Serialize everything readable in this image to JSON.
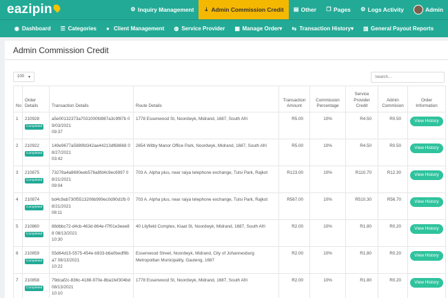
{
  "app": {
    "logo_text": "eazipin"
  },
  "top_nav": [
    {
      "label": "Inquiry Management",
      "icon": "gear-icon",
      "glyph": "⚙",
      "active": false
    },
    {
      "label": "Admin Commission Credit",
      "icon": "download-icon",
      "glyph": "⤓",
      "active": true
    },
    {
      "label": "Other",
      "icon": "chart-icon",
      "glyph": "▤",
      "active": false
    },
    {
      "label": "Pages",
      "icon": "pages-icon",
      "glyph": "❐",
      "active": false
    },
    {
      "label": "Logs Activity",
      "icon": "gear-icon",
      "glyph": "⚙",
      "active": false
    },
    {
      "label": "Admin",
      "icon": "avatar",
      "glyph": "",
      "active": false
    }
  ],
  "sub_nav": [
    {
      "label": "Dashboard",
      "icon": "dashboard-icon",
      "glyph": "◉",
      "dropdown": false
    },
    {
      "label": "Categories",
      "icon": "list-icon",
      "glyph": "☰",
      "dropdown": false
    },
    {
      "label": "Client Management",
      "icon": "user-icon",
      "glyph": "●",
      "dropdown": false
    },
    {
      "label": "Service Provider",
      "icon": "globe-icon",
      "glyph": "◍",
      "dropdown": false
    },
    {
      "label": "Manage Order",
      "icon": "order-icon",
      "glyph": "▦",
      "dropdown": true
    },
    {
      "label": "Transaction History",
      "icon": "history-icon",
      "glyph": "⇆",
      "dropdown": true
    },
    {
      "label": "General Payout Reports",
      "icon": "report-icon",
      "glyph": "▥",
      "dropdown": false
    }
  ],
  "page": {
    "title": "Admin Commission Credit",
    "page_size": "100",
    "search_placeholder": "Search..."
  },
  "table": {
    "headers": {
      "no": "No",
      "order": "Order Details",
      "transaction": "Transaction Details",
      "route": "Route Details",
      "amount": "Transaction Amount",
      "percentage": "Commission Percentage",
      "provider_credit": "Service Provider Credit",
      "admin_commission": "Admin Commision",
      "info": "Order Information"
    },
    "status_label": "Completed",
    "action_label": "View History",
    "rows": [
      {
        "no": "1",
        "order_id": "210928",
        "tx_id": "a5e00132373a7031000fd987a3c9f87b",
        "date": "09/03/2021",
        "time": "09:37",
        "route": "1778 Essenwood St, Noordwyk, Midrand, 1687, South Afri",
        "amount": "R5.00",
        "pct": "10%",
        "provider": "R4.50",
        "admin": "R0.50"
      },
      {
        "no": "2",
        "order_id": "210922",
        "tx_id": "149e9677a5989fd342ae44213df68868",
        "date": "08/27/2021",
        "time": "03:42",
        "route": "2654 Witby Manor Office Park, Noordwyk, Midrand, 1687, South Afri",
        "amount": "R5.00",
        "pct": "10%",
        "provider": "R4.50",
        "admin": "R0.50"
      },
      {
        "no": "3",
        "order_id": "210875",
        "tx_id": "73278a4a8690eeb576a8fd4c9ec6997",
        "date": "08/21/2021",
        "time": "09:04",
        "route": "703 A. Alpha plus, near raiya telephone exchange, Tulsi Park, Rajkot",
        "amount": "R123.00",
        "pct": "10%",
        "provider": "R110.70",
        "admin": "R12.30"
      },
      {
        "no": "4",
        "order_id": "210874",
        "tx_id": "bd4c9ab730f5513206b999ec0d90d1fb",
        "date": "08/21/2021",
        "time": "08:11",
        "route": "703 A. Alpha plus, near raiya telephone exchange, Tulsi Park, Rajkot",
        "amount": "R567.00",
        "pct": "10%",
        "provider": "R510.30",
        "admin": "R56.70"
      },
      {
        "no": "5",
        "order_id": "210860",
        "tx_id": "88dbbc72-d4cb-463d-864e-f7f01e3eee88",
        "date": "08/13/2021",
        "time": "10:30",
        "route": "40 Lilyfield Complex, Kiaat St, Noordwyk, Midrand, 1687, South Afri",
        "amount": "R2.00",
        "pct": "10%",
        "provider": "R1.80",
        "admin": "R0.20"
      },
      {
        "no": "6",
        "order_id": "210859",
        "tx_id": "55d64d15-5575-454e-b933-b6a0bedf9ba7",
        "date": "08/13/2021",
        "time": "10:22",
        "route": "Essenwood Street, Noordwyk, Midrand, City of Johannesburg Metropolitan Municipality, Gauteng, 1687",
        "amount": "R2.00",
        "pct": "10%",
        "provider": "R1.80",
        "admin": "R0.20"
      },
      {
        "no": "7",
        "order_id": "210858",
        "tx_id": "79dcaf2c-836c-4188-970e-8ba1fef304bd",
        "date": "08/13/2021",
        "time": "10:10",
        "route": "1778 Essenwood St, Noordwyk, Midrand, 1687, South Afri",
        "amount": "R2.00",
        "pct": "10%",
        "provider": "R1.80",
        "admin": "R0.20"
      }
    ]
  },
  "colors": {
    "brand": "#22aa96",
    "active_tab": "#f5b800",
    "button": "#2fc39d",
    "logo_pin": "#f5c400"
  }
}
